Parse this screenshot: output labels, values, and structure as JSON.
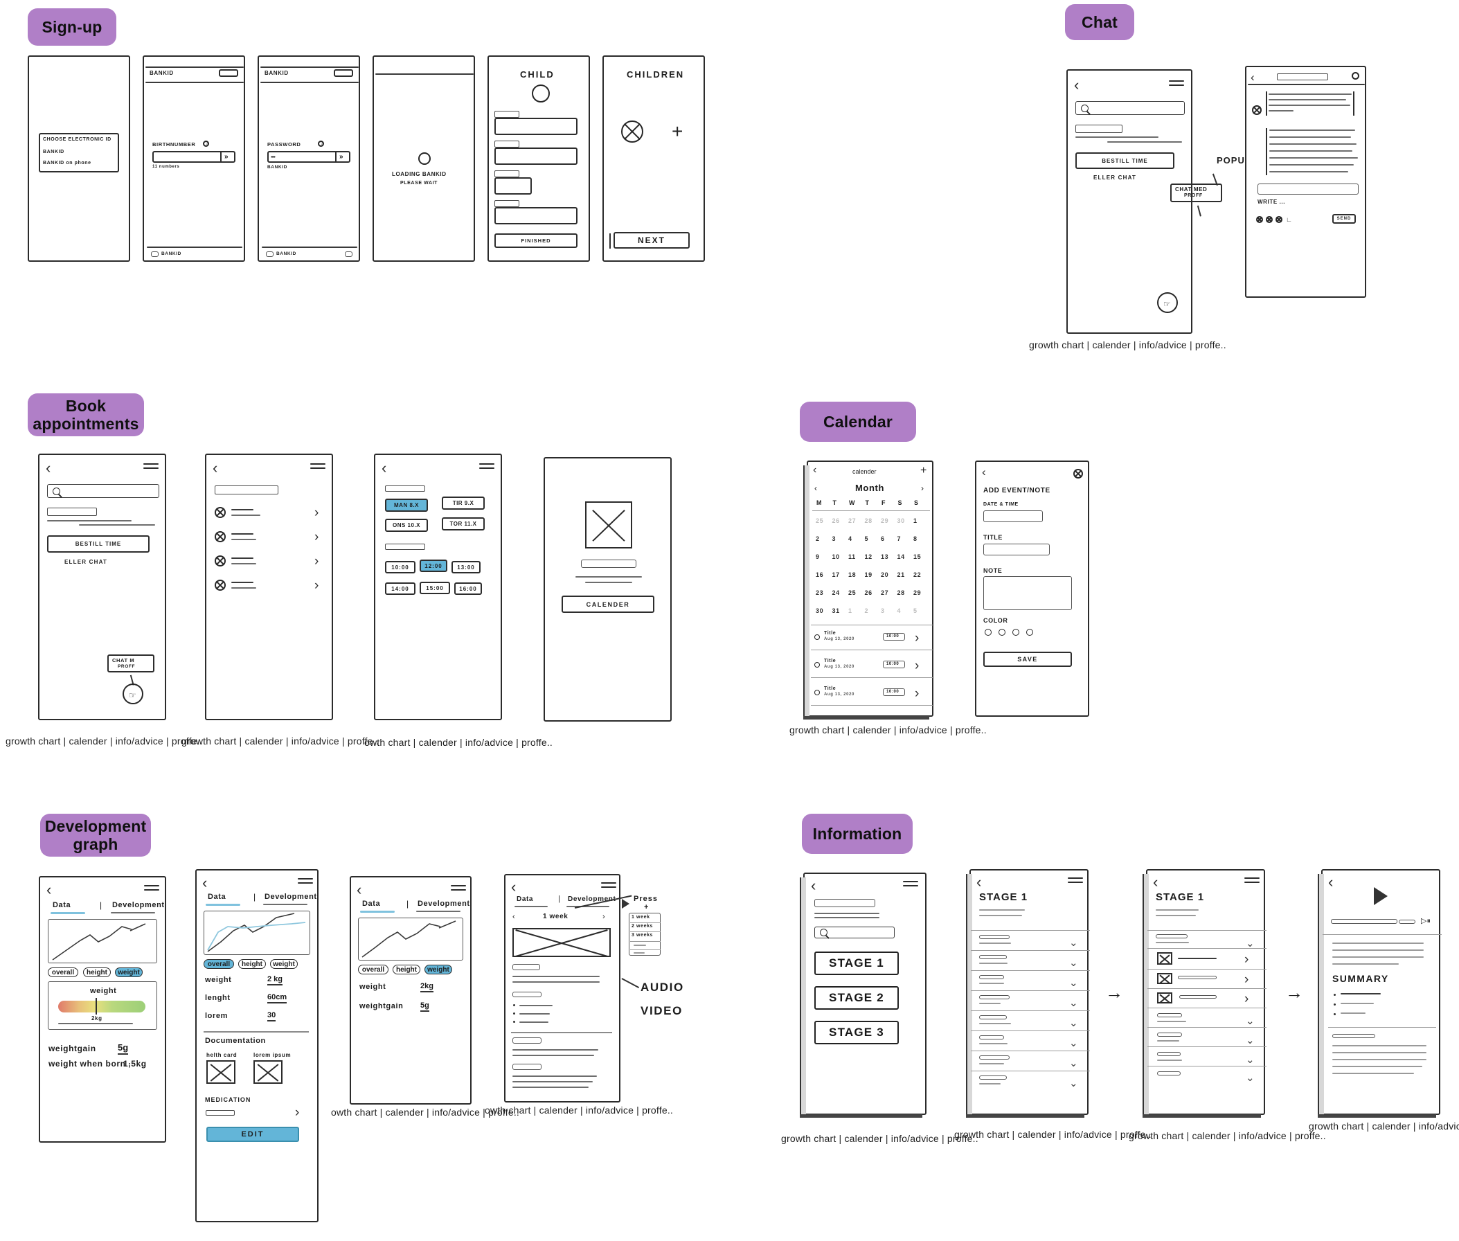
{
  "board": {
    "sections": [
      {
        "id": "signup",
        "label": "Sign-up"
      },
      {
        "id": "chat",
        "label": "Chat"
      },
      {
        "id": "book",
        "label": "Book\nappointments"
      },
      {
        "id": "calendar",
        "label": "Calendar"
      },
      {
        "id": "devgraph",
        "label": "Development\ngraph"
      },
      {
        "id": "information",
        "label": "Information"
      }
    ],
    "accent_color": "#b07fc7",
    "highlight_color": "#63b5d8",
    "ink_color": "#2b2b2b"
  },
  "bottom_nav": {
    "full": "growth chart | calender | info/advice | proffe..",
    "items": [
      "growth chart",
      "calender",
      "info/advice",
      "proffe.."
    ],
    "truncated_left": "owth chart | calender | info/advice | proffe..",
    "truncated_left2": "th chart | calender | info/advice | proffe"
  },
  "signup": {
    "screen1": {
      "options_title": "CHOOSE ELECTRONIC ID",
      "option1": "BANKID",
      "option2": "BANKID on phone"
    },
    "screen2": {
      "appbar": "BANKID",
      "field_label": "BIRTHNUMBER",
      "help": "?",
      "hint": "11 numbers",
      "submit": "»",
      "tabbar": "BANKID"
    },
    "screen3": {
      "appbar": "BANKID",
      "field_label": "PASSWORD",
      "help": "?",
      "field_value": "••••",
      "sub": "BANKID",
      "submit": "»",
      "tabbar": "BANKID"
    },
    "screen4": {
      "loading_line1": "LOADING BANKID",
      "loading_line2": "PLEASE WAIT"
    },
    "screen5": {
      "title": "CHILD",
      "finished": "FINISHED"
    },
    "screen6": {
      "title": "CHILDREN",
      "add": "+",
      "next": "NEXT"
    }
  },
  "chat": {
    "list_screen": {
      "search_placeholder": "",
      "primary_button": "BESTILL TIME",
      "or_label": "ELLER CHAT"
    },
    "annotations": {
      "popup": "POPUP",
      "popup_box_line1": "CHAT MED",
      "popup_box_line2": "PROFF"
    },
    "thread_screen": {
      "compose_placeholder": "WRITE ...",
      "send": "SEND",
      "attach_icons": [
        "image-icon",
        "camera-icon",
        "file-icon",
        "more-icon"
      ]
    }
  },
  "book": {
    "screen1": {
      "primary_button": "BESTILL TIME",
      "or_label": "ELLER CHAT",
      "popup_line1": "CHAT M",
      "popup_line2": "PROFF"
    },
    "screen2": {
      "rows": 4,
      "chevron": "›"
    },
    "screen3": {
      "days": [
        {
          "label": "MAN 8.x",
          "selected": true
        },
        {
          "label": "TIR 9.x",
          "selected": false
        },
        {
          "label": "ONS 10.x",
          "selected": false
        },
        {
          "label": "TOR 11.x",
          "selected": false
        }
      ],
      "times": [
        {
          "label": "10:00",
          "selected": false
        },
        {
          "label": "12:00",
          "selected": true
        },
        {
          "label": "13:00",
          "selected": false
        },
        {
          "label": "14:00",
          "selected": false
        },
        {
          "label": "15:00",
          "selected": false
        },
        {
          "label": "16:00",
          "selected": false
        }
      ]
    },
    "screen4": {
      "button": "CALENDER"
    }
  },
  "calendar": {
    "month_screen": {
      "title": "calender",
      "add": "+",
      "month_label": "Month",
      "prev": "‹",
      "next": "›",
      "weekdays": [
        "M",
        "T",
        "W",
        "T",
        "F",
        "S",
        "S"
      ],
      "weeks": [
        [
          "25",
          "26",
          "27",
          "28",
          "29",
          "30",
          "1"
        ],
        [
          "2",
          "3",
          "4",
          "5",
          "6",
          "7",
          "8"
        ],
        [
          "9",
          "10",
          "11",
          "12",
          "13",
          "14",
          "15"
        ],
        [
          "16",
          "17",
          "18",
          "19",
          "20",
          "21",
          "22"
        ],
        [
          "23",
          "24",
          "25",
          "26",
          "27",
          "28",
          "29"
        ],
        [
          "30",
          "31",
          "1",
          "2",
          "3",
          "4",
          "5"
        ]
      ],
      "events": [
        {
          "title": "Title",
          "date": "Aug 13, 2020",
          "time": "10:00"
        },
        {
          "title": "Title",
          "date": "Aug 13, 2020",
          "time": "10:00"
        },
        {
          "title": "Title",
          "date": "Aug 13, 2020",
          "time": "10:00"
        }
      ]
    },
    "add_screen": {
      "heading": "ADD EVENT/NOTE",
      "datetime_label": "DATE & TIME",
      "title_label": "TITLE",
      "note_label": "NOTE",
      "color_label": "COLOR",
      "color_count": 4,
      "save": "SAVE"
    }
  },
  "devgraph": {
    "tabs": {
      "data": "Data",
      "development": "Development",
      "separator": "|"
    },
    "chips": [
      "overall",
      "height",
      "weight"
    ],
    "screen1": {
      "selected_chip": "weight",
      "gauge_label": "weight",
      "gauge_value": "2kg",
      "rows": [
        {
          "key": "weightgain",
          "value": "5g"
        },
        {
          "key": "weight when born ·",
          "value": "1,5kg"
        }
      ]
    },
    "screen2": {
      "selected_chip": "overall",
      "rows": [
        {
          "key": "weight",
          "value": "2 kg"
        },
        {
          "key": "lenght",
          "value": "60cm"
        },
        {
          "key": "lorem",
          "value": "30"
        }
      ],
      "documentation_label": "Documentation",
      "doc_items": [
        "helth card",
        "lorem ipsum"
      ],
      "medication_label": "MEDICATION",
      "edit_button": "EDIT"
    },
    "screen3": {
      "selected_chip": "weight",
      "rows": [
        {
          "key": "weight",
          "value": "2kg"
        },
        {
          "key": "weightgain",
          "value": "5g"
        }
      ]
    },
    "screen4": {
      "period": "1 week",
      "prev": "‹",
      "next": "›",
      "annotation_press": "Press",
      "annotation_plus": "+",
      "dropdown_options": [
        "1 week",
        "2 weeks",
        "3 weeks"
      ],
      "annotation_audio": "AUDIO",
      "annotation_video": "VIDEO"
    }
  },
  "information": {
    "screen1": {
      "stages": [
        "STAGE 1",
        "STAGE 2",
        "STAGE 3"
      ],
      "search_placeholder": ""
    },
    "screen2": {
      "heading": "STAGE 1",
      "accordion_rows": 8,
      "chevron": "⌄"
    },
    "screen3": {
      "heading": "STAGE 1",
      "accordion_rows": 5,
      "media_rows": 3,
      "chevron": "⌄",
      "arrow": "›"
    },
    "screen4": {
      "summary_heading": "SUMMARY",
      "play_icon": "play-icon",
      "speed": "▷⏸"
    },
    "flow_arrow": "→"
  }
}
